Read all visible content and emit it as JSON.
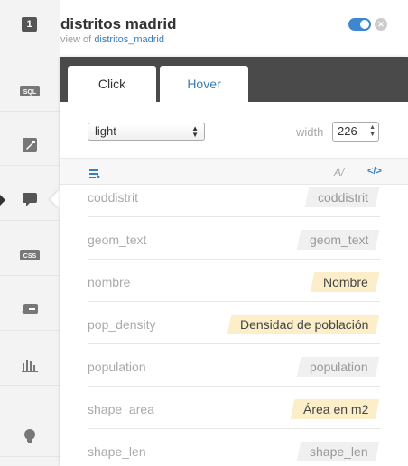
{
  "header": {
    "layer_number": "1",
    "title": "distritos madrid",
    "subtitle_prefix": "view of",
    "subtitle_link": "distritos_madrid"
  },
  "rail": [
    {
      "name": "sql-icon",
      "label": "SQL"
    },
    {
      "name": "wizard-icon",
      "label": ""
    },
    {
      "name": "infowindow-icon",
      "label": "",
      "active": true
    },
    {
      "name": "css-icon",
      "label": "CSS"
    },
    {
      "name": "legend-icon",
      "label": ""
    },
    {
      "name": "filters-icon",
      "label": ""
    },
    {
      "name": "lightbulb-icon",
      "label": ""
    }
  ],
  "tabs": {
    "click": "Click",
    "hover": "Hover"
  },
  "controls": {
    "style_value": "light",
    "width_label": "width",
    "width_value": "226"
  },
  "toolbar": {
    "title_icon": "A/",
    "code_icon": "</>"
  },
  "fields": [
    {
      "name": "coddistrit",
      "title": "coddistrit",
      "custom": false
    },
    {
      "name": "geom_text",
      "title": "geom_text",
      "custom": false
    },
    {
      "name": "nombre",
      "title": "Nombre",
      "custom": true
    },
    {
      "name": "pop_density",
      "title": "Densidad de población",
      "custom": true
    },
    {
      "name": "population",
      "title": "population",
      "custom": false
    },
    {
      "name": "shape_area",
      "title": "Área en m2",
      "custom": true
    },
    {
      "name": "shape_len",
      "title": "shape_len",
      "custom": false
    }
  ],
  "colors": {
    "accent": "#397dba",
    "toggle": "#3e86d0",
    "custom_title_bg": "#fbeec9"
  }
}
